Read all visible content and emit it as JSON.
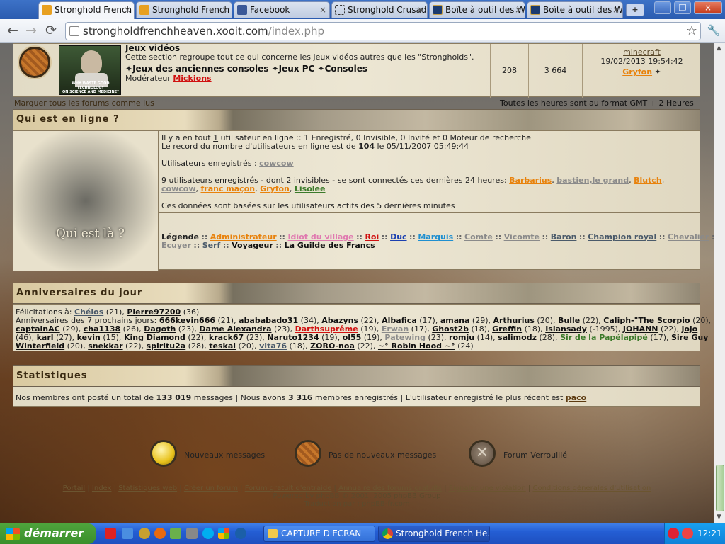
{
  "browser": {
    "tabs": [
      {
        "label": "Stronghold French",
        "icon": "stronghold-icon",
        "active": true
      },
      {
        "label": "Stronghold French",
        "icon": "stronghold-icon",
        "active": false
      },
      {
        "label": "Facebook",
        "icon": "facebook-icon",
        "active": false
      },
      {
        "label": "Stronghold Crusad",
        "icon": "loading-icon",
        "active": false
      },
      {
        "label": "Boîte à outil des W",
        "icon": "league-icon",
        "active": false
      },
      {
        "label": "Boîte à outil des W",
        "icon": "league-icon",
        "active": false
      }
    ],
    "close_glyph": "×",
    "new_tab_glyph": "+",
    "url_host": "strongholdfrenchheaven.xooit.com",
    "url_path": "/index.php",
    "win_minimize": "–",
    "win_restore": "❐",
    "win_close": "×",
    "back_glyph": "←",
    "forward_glyph": "→",
    "reload_glyph": "⟳",
    "star_glyph": "☆",
    "wrench_glyph": "🔧"
  },
  "forum": {
    "title": "Jeux vidéos",
    "description": "Cette section regroupe tout ce qui concerne les jeux vidéos autres que les \"Strongholds\".",
    "subforums": [
      "Jeux des anciennes consoles",
      "Jeux PC",
      "Consoles"
    ],
    "moderator_label": "Modérateur",
    "moderator": "Mickions",
    "topics": "208",
    "posts": "3 664",
    "last_post_title": "minecraft",
    "last_post_date": "19/02/2013 19:54:42",
    "last_post_author": "Gryfon",
    "image_caption_1": "WHY WASTE GOOD TECHNOLOGY",
    "image_caption_2": "ON SCIENCE AND MEDICINE?"
  },
  "bar": {
    "mark_read": "Marquer tous les forums comme lus",
    "timezone": "Toutes les heures sont au format GMT + 2 Heures"
  },
  "online": {
    "heading": "Qui est en ligne ?",
    "image_caption": "Qui est là ?",
    "line1_a": "Il y a en tout ",
    "line1_b": "1",
    "line1_c": " utilisateur en ligne :: 1 Enregistré, 0 Invisible, 0 Invité et 0 Moteur de recherche",
    "line2_a": "Le record du nombre d'utilisateurs en ligne est de ",
    "line2_b": "104",
    "line2_c": " le 05/11/2007 05:49:44",
    "registered_label": "Utilisateurs enregistrés : ",
    "registered_user": "cowcow",
    "recent_text": "9 utilisateurs enregistrés - dont 2 invisibles - se sont connectés ces dernières 24 heures: ",
    "recent_users": [
      {
        "name": "Barbarius",
        "cls": "orange"
      },
      {
        "name": "bastien,le grand",
        "cls": "gray"
      },
      {
        "name": "Blutch",
        "cls": "orange"
      },
      {
        "name": "cowcow",
        "cls": "gray"
      },
      {
        "name": "franc maçon",
        "cls": "orange"
      },
      {
        "name": "Gryfon",
        "cls": "orange"
      },
      {
        "name": "Lisolee",
        "cls": "green"
      }
    ],
    "note": "Ces données sont basées sur les utilisateurs actifs des 5 dernières minutes",
    "legend_label": "Légende",
    "legend": [
      {
        "name": "Administrateur",
        "cls": "orange"
      },
      {
        "name": "Idiot du village",
        "cls": "pink"
      },
      {
        "name": "Roi",
        "cls": "red"
      },
      {
        "name": "Duc",
        "cls": "blue"
      },
      {
        "name": "Marquis",
        "cls": "cyan"
      },
      {
        "name": "Comte",
        "cls": "gray"
      },
      {
        "name": "Vicomte",
        "cls": "gray"
      },
      {
        "name": "Baron",
        "cls": "slate"
      },
      {
        "name": "Champion royal",
        "cls": "slate"
      },
      {
        "name": "Chevalier",
        "cls": "gray"
      },
      {
        "name": "Ecuyer",
        "cls": "gray"
      },
      {
        "name": "Serf",
        "cls": "slate"
      },
      {
        "name": "Voyageur",
        "cls": "dk"
      },
      {
        "name": "La Guilde des Francs",
        "cls": "dk"
      }
    ]
  },
  "birthdays": {
    "heading": "Anniversaires du jour",
    "congrats": "Félicitations à: ",
    "today": [
      {
        "name": "Chélos",
        "cls": "slate",
        "age": " (21), "
      },
      {
        "name": "Pierre97200",
        "cls": "dk",
        "age": " (36)"
      }
    ],
    "next_label": "Anniversaires des 7 prochains jours: ",
    "row1": [
      [
        "666kevin666",
        "dk",
        " (21), "
      ],
      [
        "abababado31",
        "dk",
        " (34), "
      ],
      [
        "Abazyns",
        "dk",
        " (22), "
      ],
      [
        "Albafica",
        "dk",
        " (17), "
      ],
      [
        "amana",
        "dk",
        " (29), "
      ],
      [
        "Arthurius",
        "dk",
        " (20), "
      ],
      [
        "Bulle",
        "dk",
        " (22), "
      ],
      [
        "Caliph-\"The Scorpio",
        "dk",
        " (20),"
      ]
    ],
    "row2": [
      [
        "captainAC",
        "dk",
        " (29), "
      ],
      [
        "cha1138",
        "dk",
        " (26), "
      ],
      [
        "Dagoth",
        "dk",
        " (23), "
      ],
      [
        "Dame Alexandra",
        "dk",
        " (23), "
      ],
      [
        "Darthsuprême",
        "red",
        " (19), "
      ],
      [
        "Erwan",
        "gray",
        " (17), "
      ],
      [
        "Ghost2b",
        "dk",
        " (18), "
      ],
      [
        "Greffin",
        "dk",
        " (18), "
      ],
      [
        "Islansady",
        "dk",
        " (-1995), "
      ],
      [
        "JOHANN",
        "dk",
        " (22), "
      ],
      [
        "jojo",
        "dk",
        ""
      ]
    ],
    "row3": [
      [
        "",
        "dk",
        "(46), "
      ],
      [
        "karl",
        "dk",
        " (27), "
      ],
      [
        "kevin",
        "dk",
        " (15), "
      ],
      [
        "King Diamond",
        "dk",
        " (22), "
      ],
      [
        "krack67",
        "dk",
        " (23), "
      ],
      [
        "Naruto1234",
        "dk",
        " (19), "
      ],
      [
        "ol55",
        "dk",
        " (19), "
      ],
      [
        "Patewing",
        "gray",
        " (23), "
      ],
      [
        "romju",
        "dk",
        " (14), "
      ],
      [
        "salimodz",
        "dk",
        " (28), "
      ],
      [
        "Sir de la Papélapipé",
        "green",
        " (17), "
      ],
      [
        "Sire Guy",
        "dk",
        ""
      ]
    ],
    "row4": [
      [
        "Winterfield",
        "dk",
        " (20), "
      ],
      [
        "snekkar",
        "dk",
        " (22), "
      ],
      [
        "spiritu2a",
        "dk",
        " (28), "
      ],
      [
        "teskal",
        "dk",
        " (20), "
      ],
      [
        "vita76",
        "slate",
        " (18), "
      ],
      [
        "ZORO-noa",
        "dk",
        " (22), "
      ],
      [
        "~° Robin Hood ~°",
        "dk",
        " (24)"
      ]
    ]
  },
  "stats": {
    "heading": "Statistiques",
    "t1": "Nos membres ont posté un total de ",
    "posts": "133 019",
    "t2": " messages | Nous avons ",
    "members": "3 316",
    "t3": " membres enregistrés | L'utilisateur enregistré le plus récent est ",
    "newest": "paco"
  },
  "legend_icons": {
    "new": "Nouveaux messages",
    "none": "Pas de nouveaux messages",
    "locked": "Forum Verrouillé"
  },
  "footer": {
    "links": [
      "Portail",
      "Index",
      "Statistiques web",
      "Créer un forum",
      "Forum gratuit d'entraide",
      "Annuaire des forums gratuits",
      "Signaler une violation",
      "Conditions générales d'utilisation"
    ],
    "powered": "Powered by phpBB © 2001, 2005 phpBB Group",
    "translation": "Traduction par : phpBB-fr.com"
  },
  "taskbar": {
    "start": "démarrer",
    "items": [
      "CAPTURE D'ECRAN",
      "Stronghold French He..."
    ],
    "clock": "12:21"
  },
  "colors": {
    "accent": "#e8820c",
    "admin": "#e8820c",
    "roi": "#d01010",
    "duc": "#1a3fb0",
    "marquis": "#1f8fd0"
  }
}
